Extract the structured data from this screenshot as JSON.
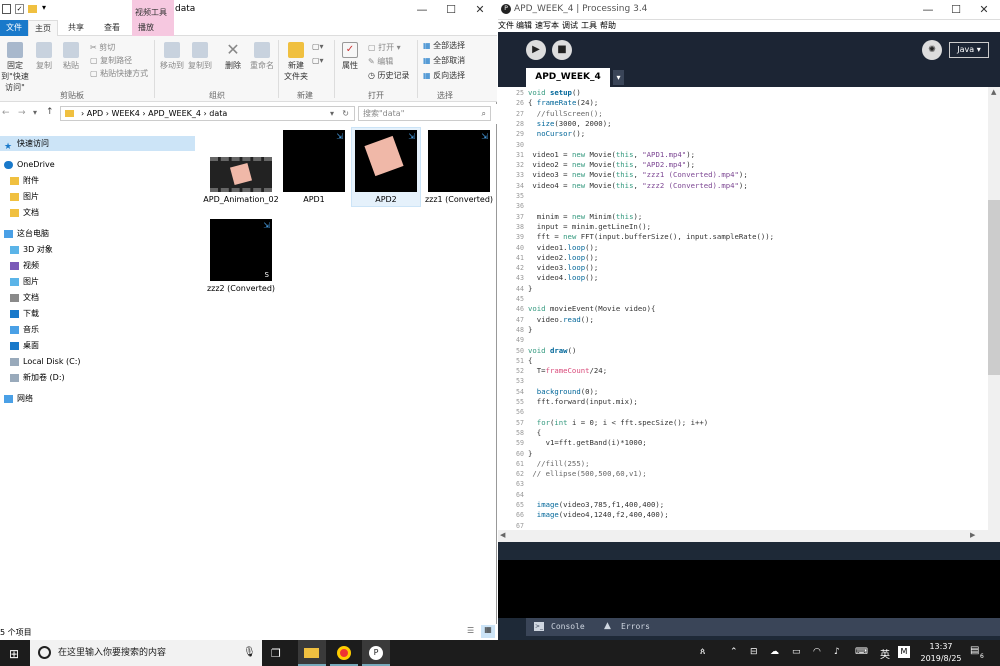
{
  "explorer": {
    "title": "data",
    "tool_tab": "视频工具",
    "tabs": [
      "文件",
      "主页",
      "共享",
      "查看",
      "播放"
    ],
    "ribbon": {
      "pin": "固定到\"快速访问\"",
      "copy": "复制",
      "paste": "粘贴",
      "cut": "剪切",
      "copy_path": "复制路径",
      "paste_shortcut": "粘贴快捷方式",
      "clipboard": "剪贴板",
      "move_to": "移动到",
      "copy_to": "复制到",
      "delete": "删除",
      "rename": "重命名",
      "organize": "组织",
      "new_folder": "新建\n文件夹",
      "new": "新建",
      "properties": "属性",
      "open": "打开 ▾",
      "edit": "编辑",
      "history": "历史记录",
      "open_group": "打开",
      "select_all": "全部选择",
      "select_none": "全部取消",
      "invert": "反向选择",
      "select_group": "选择"
    },
    "address": {
      "parts": [
        "APD",
        "WEEK4",
        "APD_WEEK_4",
        "data"
      ],
      "search_placeholder": "搜索\"data\""
    },
    "nav": [
      {
        "label": "快速访问",
        "level": 0
      },
      {
        "label": "OneDrive",
        "level": 0
      },
      {
        "label": "附件",
        "level": 1
      },
      {
        "label": "图片",
        "level": 1
      },
      {
        "label": "文档",
        "level": 1
      },
      {
        "label": "这台电脑",
        "level": 0
      },
      {
        "label": "3D 对象",
        "level": 1
      },
      {
        "label": "视频",
        "level": 1
      },
      {
        "label": "图片",
        "level": 1
      },
      {
        "label": "文档",
        "level": 1
      },
      {
        "label": "下载",
        "level": 1
      },
      {
        "label": "音乐",
        "level": 1
      },
      {
        "label": "桌面",
        "level": 1
      },
      {
        "label": "Local Disk (C:)",
        "level": 1
      },
      {
        "label": "新加卷 (D:)",
        "level": 1
      },
      {
        "label": "网络",
        "level": 0
      }
    ],
    "files": [
      "APD_Animation_02",
      "APD1",
      "APD2",
      "zzz1 (Converted)",
      "zzz2 (Converted)"
    ],
    "status": "5 个项目"
  },
  "processing": {
    "title": "APD_WEEK_4 | Processing 3.4",
    "menu": [
      "文件",
      "编辑",
      "速写本",
      "调试",
      "工具",
      "帮助"
    ],
    "mode": "Java ▾",
    "tab": "APD_WEEK_4",
    "tab_arrow": "▾",
    "line_numbers": [
      "25",
      "26",
      "27",
      "28",
      "29",
      "30",
      "31",
      "32",
      "33",
      "34",
      "35",
      "36",
      "37",
      "38",
      "39",
      "40",
      "41",
      "42",
      "43",
      "44",
      "45",
      "46",
      "47",
      "48",
      "49",
      "50",
      "51",
      "52",
      "53",
      "54",
      "55",
      "56",
      "57",
      "58",
      "59",
      "60",
      "61",
      "62",
      "63",
      "64",
      "65",
      "66",
      "67"
    ],
    "console_tab": "Console",
    "errors_tab": "Errors"
  },
  "taskbar": {
    "search_placeholder": "在这里输入你要搜索的内容",
    "ime": "英",
    "time": "13:37",
    "date": "2019/8/25",
    "notifications": "6"
  }
}
